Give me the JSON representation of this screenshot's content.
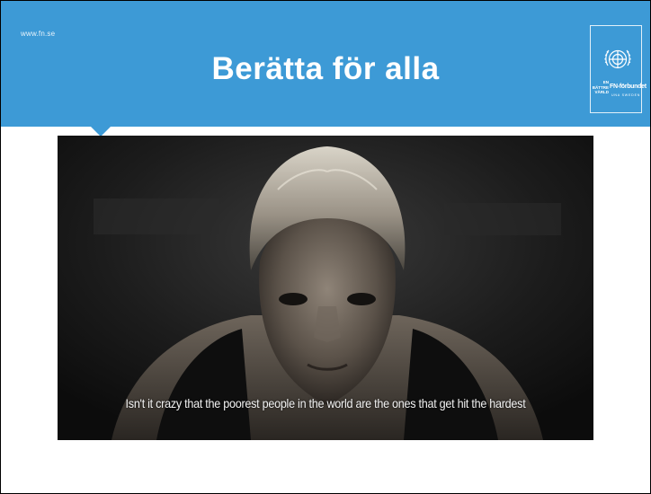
{
  "slide": {
    "site_url": "www.fn.se",
    "title": "Berätta för alla",
    "header_color": "#3d9ad6"
  },
  "logo": {
    "emblem": "un-emblem-icon",
    "tagline": [
      "EN",
      "BÄTTRE",
      "VÄRLD"
    ],
    "org_name": "FN-förbundet",
    "sub_text": "UNA SWEDEN"
  },
  "photo": {
    "caption": "Isn't it crazy that the poorest people in the world are the ones that get hit the hardest"
  }
}
